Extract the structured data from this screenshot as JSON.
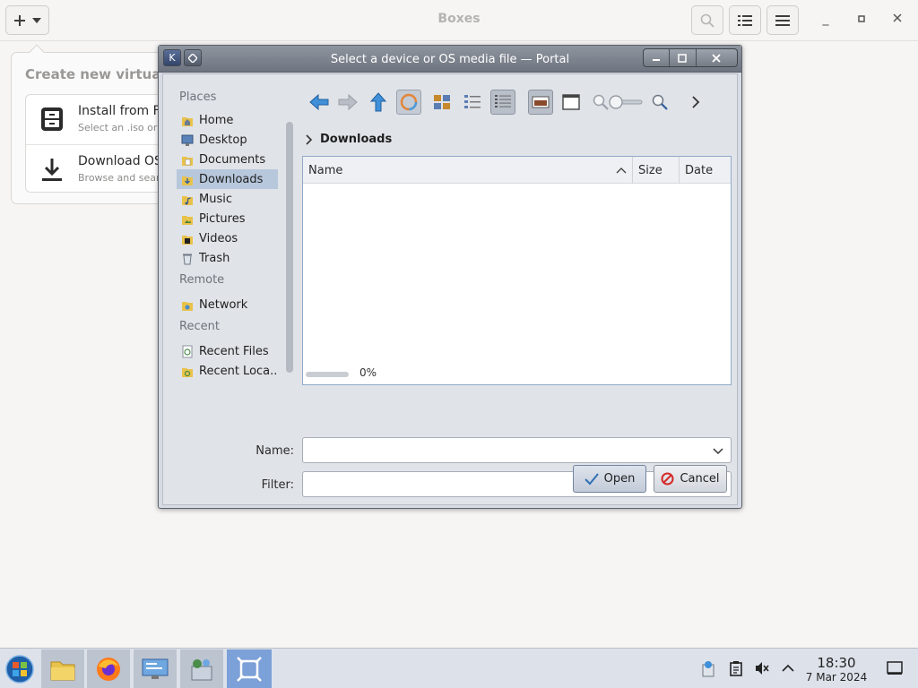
{
  "boxes": {
    "title": "Boxes",
    "popover_title": "Create new virtual machine",
    "items": [
      {
        "title": "Install from File",
        "subtitle": "Select an .iso or .img file"
      },
      {
        "title": "Download OS",
        "subtitle": "Browse and search for operating systems to install"
      }
    ]
  },
  "dialog": {
    "title": "Select a device or OS media file — Portal",
    "places": {
      "places_header": "Places",
      "places_items": [
        "Home",
        "Desktop",
        "Documents",
        "Downloads",
        "Music",
        "Pictures",
        "Videos",
        "Trash"
      ],
      "remote_header": "Remote",
      "remote_items": [
        "Network"
      ],
      "recent_header": "Recent",
      "recent_items": [
        "Recent Files",
        "Recent Loca..."
      ],
      "selected": "Downloads"
    },
    "breadcrumb": "Downloads",
    "columns": [
      "Name",
      "Size",
      "Date"
    ],
    "sort_column": "Name",
    "progress_text": "0%",
    "progress_value": 0,
    "name_label": "Name:",
    "name_value": "",
    "filter_label": "Filter:",
    "filter_value": "",
    "open_label": "Open",
    "cancel_label": "Cancel"
  },
  "taskbar": {
    "time": "18:30",
    "date": "7 Mar 2024"
  },
  "colors": {
    "selection": "#b7c7dc",
    "active_task": "#7ca0d8",
    "list_border": "#92a9c8"
  }
}
